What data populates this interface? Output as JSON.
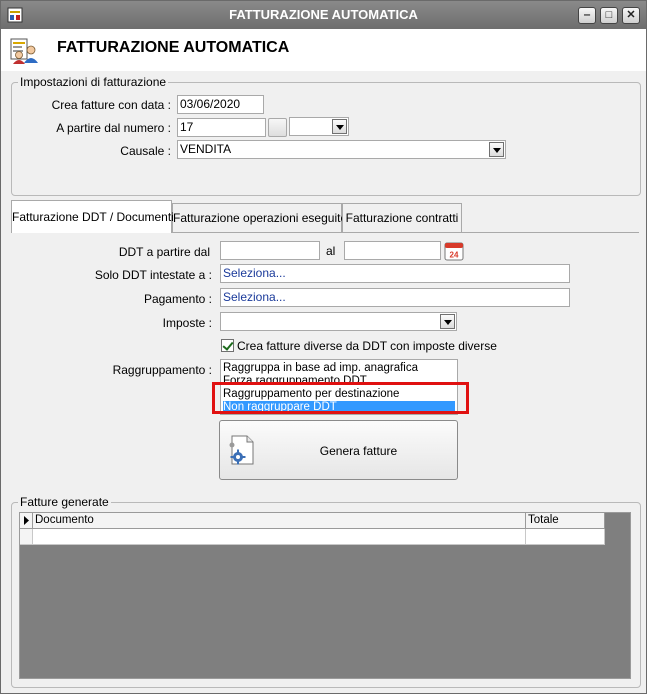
{
  "window": {
    "title": "FATTURAZIONE AUTOMATICA",
    "minimize_glyph": "‒",
    "maximize_glyph": "□",
    "close_glyph": "✕"
  },
  "header": {
    "title": "FATTURAZIONE AUTOMATICA"
  },
  "settings": {
    "group_title": "Impostazioni di fatturazione",
    "date_label": "Crea fatture con data :",
    "date_value": "03/06/2020",
    "number_label": "A partire dal numero :",
    "number_value": "17",
    "series_value": "",
    "causale_label": "Causale :",
    "causale_value": "VENDITA"
  },
  "tabs": [
    {
      "label": "Fatturazione DDT / Documenti",
      "active": true
    },
    {
      "label": "Fatturazione operazioni eseguite",
      "active": false
    },
    {
      "label": "Fatturazione contratti",
      "active": false
    }
  ],
  "ddt": {
    "from_label": "DDT a partire dal",
    "from_value": "",
    "to_label": "al",
    "to_value": "",
    "calendar_day": "24",
    "intestate_label": "Solo DDT intestate a :",
    "intestate_value": "Seleziona...",
    "pagamento_label": "Pagamento :",
    "pagamento_value": "Seleziona...",
    "imposte_label": "Imposte :",
    "imposte_value": "",
    "checkbox_label": "Crea fatture diverse da DDT con imposte diverse",
    "checkbox_checked": true,
    "raggruppamento_label": "Raggruppamento :",
    "raggruppamento_options": [
      "Raggruppa in base ad imp. anagrafica",
      "Forza raggruppamento DDT",
      "Raggruppamento per destinazione",
      "Non raggruppare DDT"
    ],
    "raggruppamento_selected": "Non raggruppare DDT",
    "generate_label": "Genera fatture"
  },
  "results": {
    "group_title": "Fatture generate",
    "columns": [
      "Documento",
      "Totale"
    ],
    "rows": []
  },
  "colors": {
    "titlebar": "#7d7d7d",
    "selection": "#3399ff",
    "highlight_box": "#e01010",
    "link_text": "#1a3a9a",
    "grid_background": "#7f7f7f"
  }
}
